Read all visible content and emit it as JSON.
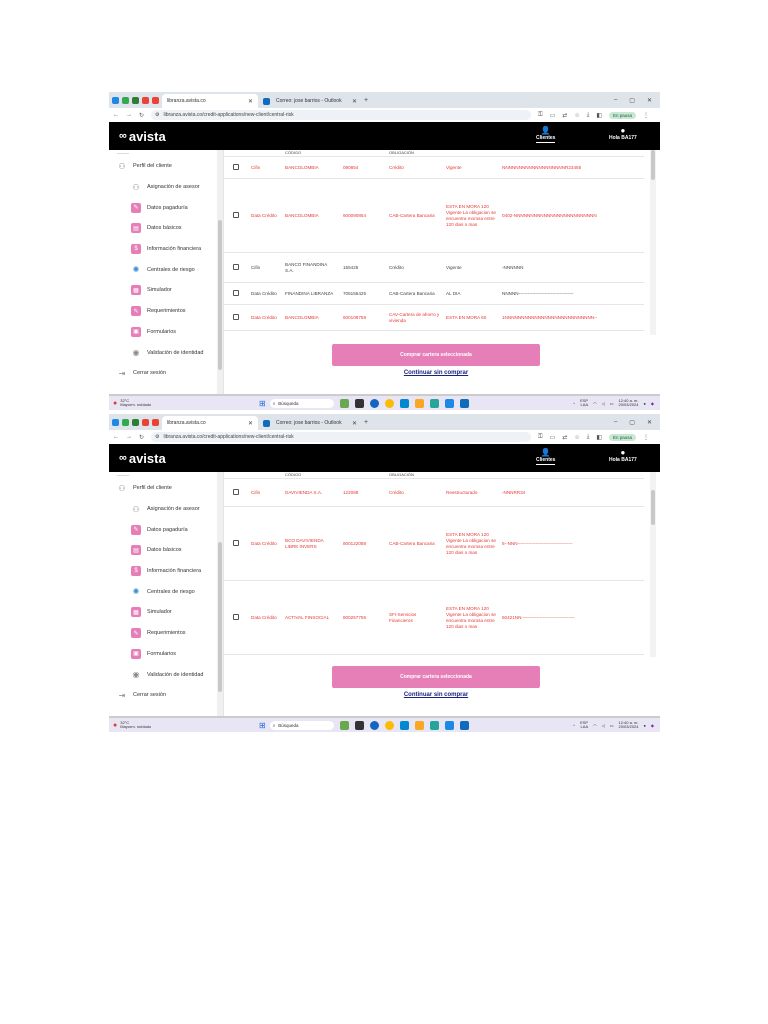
{
  "browser": {
    "tabs": [
      {
        "label": "libranza.avista.co",
        "active": true
      },
      {
        "label": "Correo: jose barrios - Outlook",
        "active": false
      }
    ],
    "new_tab": "+",
    "url": "libranza.avista.co/credit-applications/new-client/central-risk",
    "pause_label": "En pausa",
    "window_controls": [
      "–",
      "▢",
      "✕"
    ]
  },
  "app": {
    "logo_text": "avista",
    "nav_clientes": "Clientes",
    "user_greeting": "Hola BA177"
  },
  "sidebar": {
    "top_cut": "———",
    "items": [
      {
        "label": "Perfil del cliente",
        "icon": "user-icon"
      },
      {
        "label": "Asignación de asesor",
        "icon": "advisor-icon"
      },
      {
        "label": "Datos pagaduría",
        "icon": "document-edit-icon"
      },
      {
        "label": "Datos básicos",
        "icon": "id-card-icon"
      },
      {
        "label": "Información financiera",
        "icon": "finance-icon"
      },
      {
        "label": "Centrales de riesgo",
        "icon": "risk-center-icon"
      },
      {
        "label": "Simulador",
        "icon": "calculator-icon"
      },
      {
        "label": "Requerimientos",
        "icon": "requirements-icon"
      },
      {
        "label": "Formularios",
        "icon": "forms-icon"
      },
      {
        "label": "Validación de identidad",
        "icon": "identity-icon"
      },
      {
        "label": "Cerrar sesión",
        "icon": "logout-icon"
      }
    ]
  },
  "screens": [
    {
      "cut_header": [
        "",
        "",
        "CÓDIGO",
        "",
        "OBLIGACIÓN",
        "",
        ""
      ],
      "rows": [
        {
          "status": "alert",
          "c1": "Cifin",
          "c2": "BANCOLOMBIA",
          "c3": "090854",
          "c4": "Crédito",
          "c5": "Vigente",
          "c6": "NNNNNNNNNNNNNNNNNNNR23456"
        },
        {
          "status": "alert",
          "c1": "Data Crédito",
          "c2": "BANCOLOMBIA",
          "c3": "600090854",
          "c4": "CAB-Cartera Bancaria",
          "c5": "ESTA EN MORA 120 Vigente La obligacion se encuentra morosa entre 120 dias o mas",
          "c6": "0402-NNNNNNNNNNNNNNNNNNNNNNNNN"
        },
        {
          "status": "ok",
          "c1": "Cifin",
          "c2": "BANCO FINANDINA S.A.",
          "c3": "155425",
          "c4": "Crédito",
          "c5": "Vigente",
          "c6": "-NNNNNN"
        },
        {
          "status": "ok",
          "c1": "Data Crédito",
          "c2": "FINANDINA LIBRANZA",
          "c3": "705155425",
          "c4": "CAB-Cartera Bancaria",
          "c5": "AL DIA",
          "c6": "NNNNN------------------------------------"
        },
        {
          "status": "alert",
          "c1": "Data Crédito",
          "c2": "BANCOLOMBIA",
          "c3": "600108759",
          "c4": "CAV-Cartera de ahorro y vivienda",
          "c5": "ESTA EN MORA 60",
          "c6": "1NNNNNNNNNNNNNNNNNNNNNNNNNNN--"
        }
      ]
    },
    {
      "cut_header": [
        "",
        "",
        "CÓDIGO",
        "",
        "OBLIGACIÓN",
        "",
        ""
      ],
      "rows": [
        {
          "status": "alert",
          "c1": "Cifin",
          "c2": "DAVIVIENDA S.A.",
          "c3": "122088",
          "c4": "Crédito",
          "c5": "Reestructurado",
          "c6": "-NNNRR34"
        },
        {
          "status": "alert",
          "c1": "Data Crédito",
          "c2": "BCO DAVIVIENDA LIBRE INVERS",
          "c3": "800122088",
          "c4": "CAB-Cartera Bancaria",
          "c5": "ESTA EN MORA 120 Vigente La obligacion se encuentra morosa entre 120 dias o mas",
          "c6": "5--NNN------------------------------------"
        },
        {
          "status": "alert",
          "c1": "Data Crédito",
          "c2": "ACTIVAL FINSOCIAL",
          "c3": "800257755",
          "c4": "SFI-Servicios Financieros",
          "c5": "ESTA EN MORA 120 Vigente La obligacion se encuentra morosa entre 120 dias o mas",
          "c6": "50421NN-----------------------------------"
        }
      ]
    }
  ],
  "actions": {
    "buy_label": "Comprar cartera seleccionada",
    "continue_label": "Continuar sin comprar"
  },
  "taskbar": {
    "temp": "32°C",
    "weather": "Mayorm. nublado",
    "search": "Búsqueda",
    "lang": "ESP",
    "lang2": "LAA",
    "time": "12:40 a. m.",
    "date": "20/03/2024"
  }
}
